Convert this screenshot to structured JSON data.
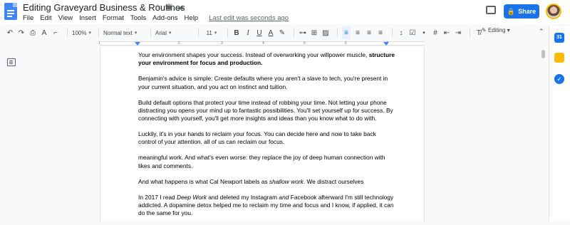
{
  "app": {
    "doc_title": "Editing Graveyard Business & Routines",
    "menus": [
      "File",
      "Edit",
      "View",
      "Insert",
      "Format",
      "Tools",
      "Add-ons",
      "Help"
    ],
    "last_edit": "Last edit was seconds ago",
    "share_label": "Share",
    "title_icons": [
      "star-icon",
      "folder-move-icon",
      "cloud-status-icon"
    ]
  },
  "toolbar": {
    "zoom": "100%",
    "style": "Normal text",
    "font": "Arial",
    "size": "11",
    "bold": "B",
    "italic": "I",
    "underline": "U",
    "text_color": "A",
    "mode": "Editing",
    "icons": [
      "undo-icon",
      "redo-icon",
      "print-icon",
      "spellcheck-icon",
      "paint-format-icon",
      "link-icon",
      "add-comment-icon",
      "insert-image-icon",
      "align-left-icon",
      "align-center-icon",
      "align-right-icon",
      "justify-icon",
      "line-spacing-icon",
      "checklist-icon",
      "bulleted-list-icon",
      "numbered-list-icon",
      "decrease-indent-icon",
      "increase-indent-icon",
      "clear-formatting-icon",
      "pencil-icon",
      "collapse-icon"
    ]
  },
  "ruler": {
    "numbers": [
      "1",
      "1",
      "2",
      "3",
      "4",
      "5",
      "6",
      "7"
    ]
  },
  "document": {
    "paragraphs": [
      {
        "segments": [
          {
            "text": "Your environment shapes your success. Instead of overworking your willpower muscle, "
          },
          {
            "text": "structure your environment for focus and production.",
            "style": "bold"
          }
        ]
      },
      {
        "segments": [
          {
            "text": "Benjamin's advice is simple: Create defaults where you aren't a slave to tech, you're present in your current situation, and you act on instinct and tuition."
          }
        ]
      },
      {
        "segments": [
          {
            "text": "Build default options that protect your time instead of robbing your time. Not letting your phone distracting you opens your mind up to fantastic possibilities. You'll set yourself up for success. By connecting with yourself, you'll get more insights and ideas than you know what to do with."
          }
        ]
      },
      {
        "segments": [
          {
            "text": "Luckily, it's in your hands to reclaim your focus. You can decide here and now to take back control of your attention. all of us can reclaim our focus."
          }
        ]
      },
      {
        "segments": [
          {
            "text": "meaningful work. And what's even worse: they replace the joy of deep human connection with likes and comments."
          }
        ]
      },
      {
        "segments": [
          {
            "text": "And what happens is what Cal Newport labels as "
          },
          {
            "text": "shallow work",
            "style": "italic"
          },
          {
            "text": ". We distract ourselves"
          }
        ]
      },
      {
        "segments": [
          {
            "text": "In 2017 I read "
          },
          {
            "text": "Deep Work",
            "style": "italic"
          },
          {
            "text": " and deleted my Instagram "
          },
          {
            "text": "and",
            "style": "italic"
          },
          {
            "text": " Facebook afterward I'm still technology addicted. A dopamine detox helped me to reclaim my time and focus and I know, if applied, it can do the same for you."
          }
        ]
      }
    ]
  },
  "colors": {
    "share_blue": "#1a73e8",
    "doc_blue": "#4285f4",
    "calendar_blue": "#1a73e8",
    "keep_yellow": "#fbbc04",
    "tasks_blue": "#1a73e8"
  }
}
